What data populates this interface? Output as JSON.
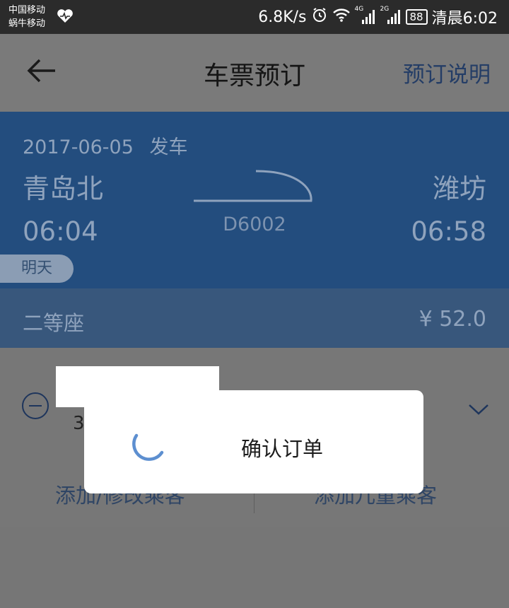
{
  "status_bar": {
    "carrier_1": "中国移动",
    "carrier_2": "蜗牛移动",
    "net_speed": "6.8K/s",
    "signal_1_tag": "4G",
    "signal_2_tag": "2G",
    "battery": "88",
    "time": "清晨6:02"
  },
  "header": {
    "title": "车票预订",
    "help_link": "预订说明"
  },
  "trip": {
    "date": "2017-06-05",
    "date_suffix": "发车",
    "from_station": "青岛北",
    "to_station": "潍坊",
    "depart_time": "06:04",
    "arrive_time": "06:58",
    "train_no": "D6002",
    "day_badge": "明天",
    "seat_class": "二等座",
    "price": "¥ 52.0"
  },
  "passenger": {
    "id_fragment": "3",
    "add_passenger_label": "添加/修改乘客",
    "add_child_label": "添加儿童乘客"
  },
  "dialog": {
    "message": "确认订单"
  },
  "colors": {
    "status_bar_bg": "#2b2b2b",
    "accent_blue": "#234d7e",
    "spinner_blue": "#5d8fd0",
    "overlay_gray": "#767676"
  }
}
